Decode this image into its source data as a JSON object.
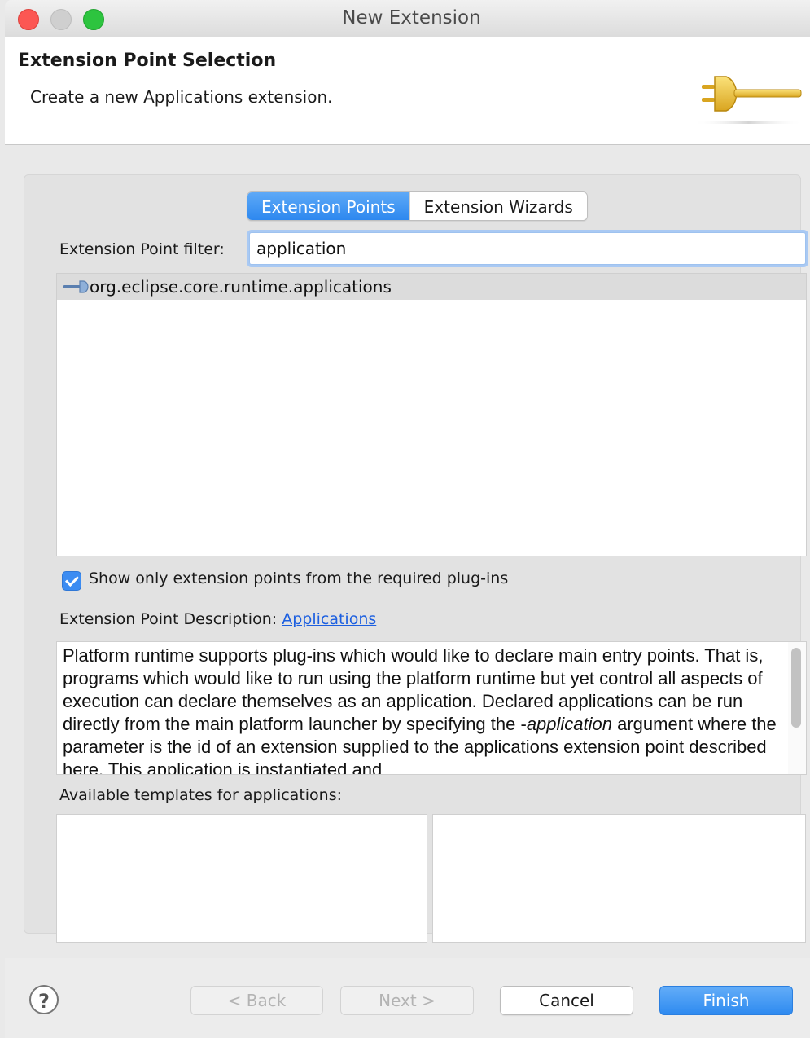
{
  "window": {
    "title": "New Extension"
  },
  "header": {
    "title": "Extension Point Selection",
    "subtitle": "Create a new Applications extension.",
    "icon": "plug-icon"
  },
  "tabs": [
    {
      "label": "Extension Points",
      "active": true
    },
    {
      "label": "Extension Wizards",
      "active": false
    }
  ],
  "filter": {
    "label": "Extension Point filter:",
    "value": "application"
  },
  "extension_points": [
    {
      "label": "org.eclipse.core.runtime.applications",
      "icon": "extension-point-icon",
      "selected": true
    }
  ],
  "show_required": {
    "label": "Show only extension points from the required plug-ins",
    "checked": true
  },
  "description": {
    "label": "Extension Point Description:",
    "link": "Applications",
    "text_part1": "Platform runtime supports plug-ins which would like to declare main entry points. That is, programs which would like to run using the platform runtime but yet control all aspects of execution can declare themselves as an application. Declared applications can be run directly from the main platform launcher by specifying the -",
    "text_italic": "application",
    "text_part2": " argument where the parameter is the id of an extension supplied to the applications extension point described here. This application is instantiated and"
  },
  "templates": {
    "label": "Available templates for applications:"
  },
  "buttons": {
    "help": "?",
    "back": "< Back",
    "next": "Next >",
    "cancel": "Cancel",
    "finish": "Finish"
  },
  "colors": {
    "accent": "#2d88ef",
    "link": "#1c5fe0",
    "close": "#fc5753",
    "zoom": "#2dc43f"
  }
}
